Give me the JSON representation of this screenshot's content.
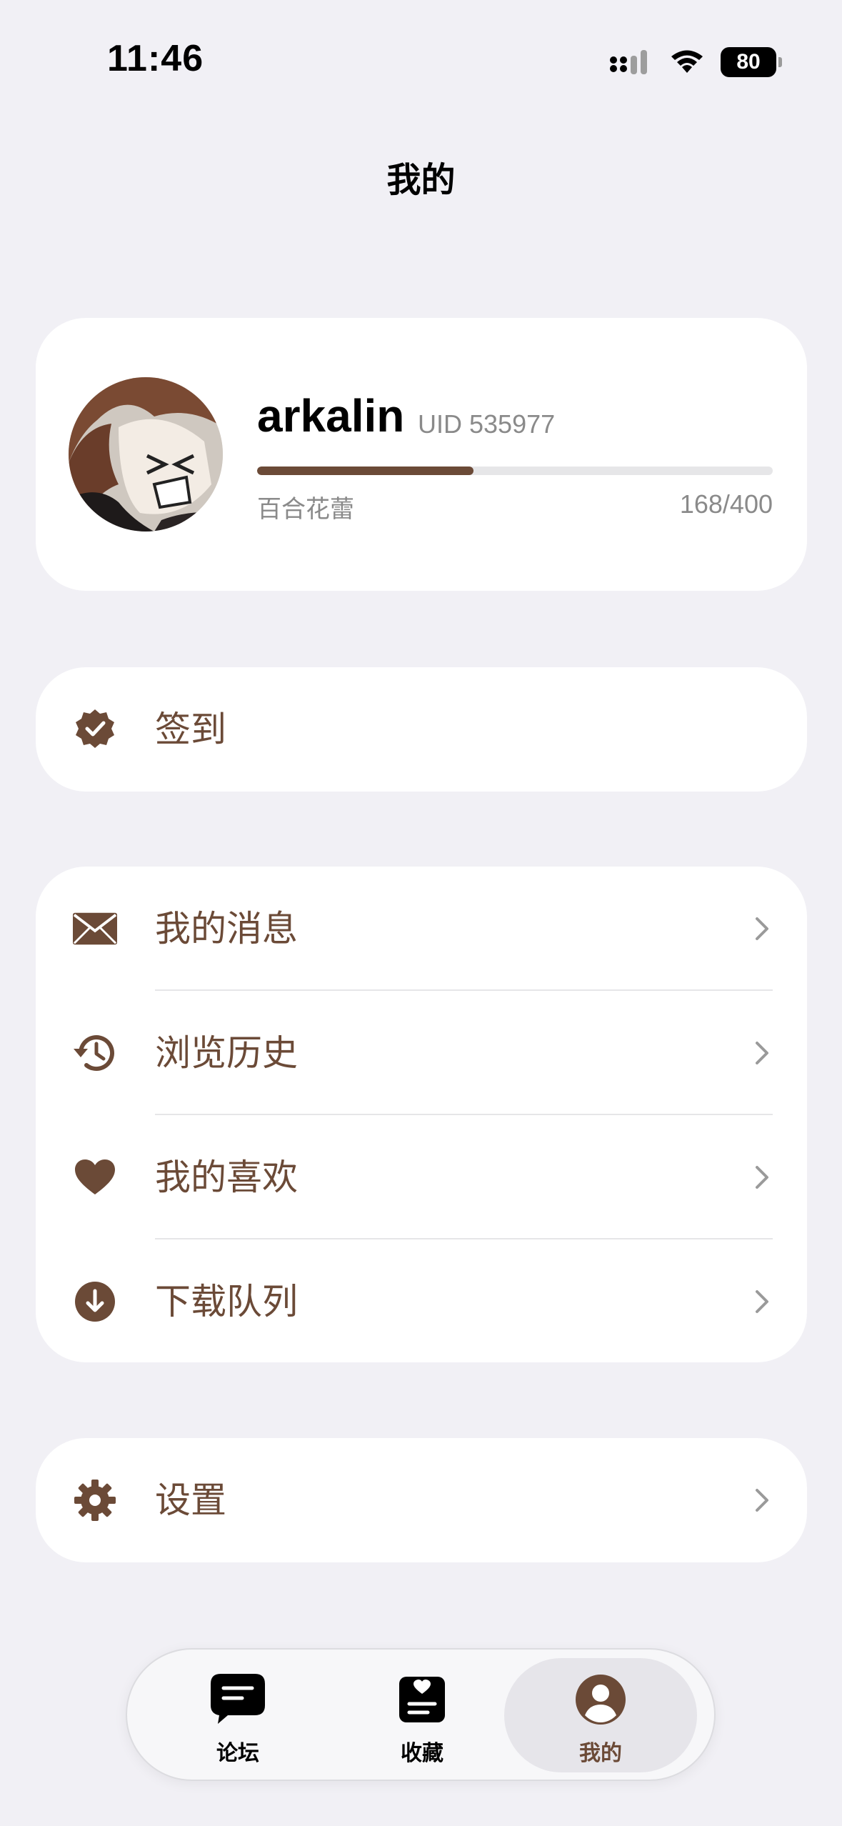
{
  "status_bar": {
    "time": "11:46",
    "battery": "80"
  },
  "nav": {
    "title": "我的"
  },
  "profile": {
    "username": "arkalin",
    "uid": "UID 535977",
    "level_name": "百合花蕾",
    "level_progress": "168/400",
    "level_fraction": 0.42
  },
  "checkin": {
    "label": "签到",
    "icon": "verified-badge-icon"
  },
  "menu": {
    "items": [
      {
        "label": "我的消息",
        "icon": "envelope-icon"
      },
      {
        "label": "浏览历史",
        "icon": "history-icon"
      },
      {
        "label": "我的喜欢",
        "icon": "heart-icon"
      },
      {
        "label": "下载队列",
        "icon": "download-icon"
      }
    ]
  },
  "settings": {
    "label": "设置",
    "icon": "gear-icon"
  },
  "tab_bar": {
    "tabs": [
      {
        "label": "论坛",
        "icon": "forum-bubble-icon"
      },
      {
        "label": "收藏",
        "icon": "bookmark-list-icon"
      },
      {
        "label": "我的",
        "icon": "person-icon",
        "active": true
      }
    ]
  },
  "colors": {
    "accent": "#6b4a37",
    "background": "#f1f0f5",
    "secondary_text": "#8a8a8a"
  }
}
